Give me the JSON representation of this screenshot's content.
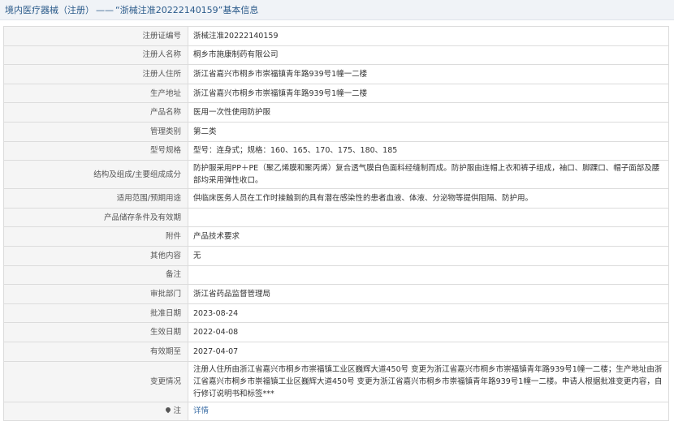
{
  "header": {
    "category": "境内医疗器械（注册）",
    "separator": "——",
    "record_title": "“浙械注准20222140159”",
    "suffix": "基本信息"
  },
  "rows": [
    {
      "label": "注册证编号",
      "value": "浙械注准20222140159"
    },
    {
      "label": "注册人名称",
      "value": "桐乡市施康制药有限公司"
    },
    {
      "label": "注册人住所",
      "value": "浙江省嘉兴市桐乡市崇福镇青年路939号1幢一二楼"
    },
    {
      "label": "生产地址",
      "value": "浙江省嘉兴市桐乡市崇福镇青年路939号1幢一二楼"
    },
    {
      "label": "产品名称",
      "value": "医用一次性使用防护服"
    },
    {
      "label": "管理类别",
      "value": "第二类"
    },
    {
      "label": "型号规格",
      "value": "型号：连身式；规格：160、165、170、175、180、185"
    },
    {
      "label": "结构及组成/主要组成成分",
      "value": "防护服采用PP＋PE（聚乙烯膜和聚丙烯）复合透气膜白色面料经缝制而成。防护服由连帽上衣和裤子组成，袖口、脚踝口、帽子面部及腰部均采用弹性收口。"
    },
    {
      "label": "适用范围/预期用途",
      "value": "供临床医务人员在工作时接触到的具有潜在感染性的患者血液、体液、分泌物等提供阻隔、防护用。"
    },
    {
      "label": "产品储存条件及有效期",
      "value": ""
    },
    {
      "label": "附件",
      "value": "产品技术要求"
    },
    {
      "label": "其他内容",
      "value": "无"
    },
    {
      "label": "备注",
      "value": ""
    },
    {
      "label": "审批部门",
      "value": "浙江省药品监督管理局"
    },
    {
      "label": "批准日期",
      "value": "2023-08-24"
    },
    {
      "label": "生效日期",
      "value": "2022-04-08"
    },
    {
      "label": "有效期至",
      "value": "2027-04-07"
    },
    {
      "label": "变更情况",
      "value": "注册人住所由浙江省嘉兴市桐乡市崇福镇工业区巍辉大道450号 变更为浙江省嘉兴市桐乡市崇福镇青年路939号1幢一二楼；生产地址由浙江省嘉兴市桐乡市崇福镇工业区巍辉大道450号 变更为浙江省嘉兴市桐乡市崇福镇青年路939号1幢一二楼。申请人根据批准变更内容，自行修订说明书和标签***"
    }
  ],
  "note": {
    "icon": "pin-icon",
    "label": "注",
    "link_text": "详情"
  }
}
